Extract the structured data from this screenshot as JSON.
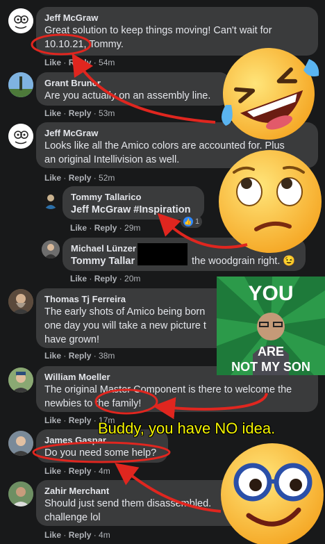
{
  "comments": [
    {
      "name": "Jeff McGraw",
      "lines": [
        "Great solution to keep things moving! Can't wait for",
        "10.10.21, Tommy."
      ],
      "time": "54m"
    },
    {
      "name": "Grant Bruner",
      "lines": [
        "Are you actually on an assembly line."
      ],
      "time": "53m"
    },
    {
      "name": "Jeff McGraw",
      "lines": [
        "Looks like all the Amico colors are accounted for. Plus",
        "an original Intellivision as well."
      ],
      "time": "52m"
    },
    {
      "name": "Tommy Tallarico",
      "lines": [
        "Jeff McGraw #Inspiration"
      ],
      "time": "29m",
      "reactions": "1"
    },
    {
      "name": "Michael Lünzer",
      "lines": [
        "Tommy Tallar",
        "the woodgrain right. 😉"
      ],
      "time": "20m"
    },
    {
      "name": "Thomas Tj Ferreira",
      "lines": [
        "The early shots of Amico being born",
        "one day you will take a new picture t",
        "have grown!"
      ],
      "time": "38m"
    },
    {
      "name": "William Moeller",
      "lines": [
        "The original Master Component is there to welcome the",
        "newbies to the family!"
      ],
      "time": "17m"
    },
    {
      "name": "James Gaspar",
      "lines": [
        "Do you need some help?"
      ],
      "time": "4m"
    },
    {
      "name": "Zahir Merchant",
      "lines": [
        "Should just send them disassembled.",
        "challenge lol"
      ],
      "time": "4m"
    }
  ],
  "actions": {
    "like": "Like",
    "reply": "Reply",
    "sep": " · "
  },
  "overlays": {
    "meme_top": "YOU",
    "meme_mid": "ARE",
    "meme_bottom": "NOT MY SON",
    "caption": "Buddy, you have NO idea."
  },
  "colors": {
    "background": "#18191a",
    "bubble": "#3a3b3c",
    "annotation": "#e0261f",
    "caption": "#f5f500",
    "meme_green": "#1e7a3a"
  }
}
